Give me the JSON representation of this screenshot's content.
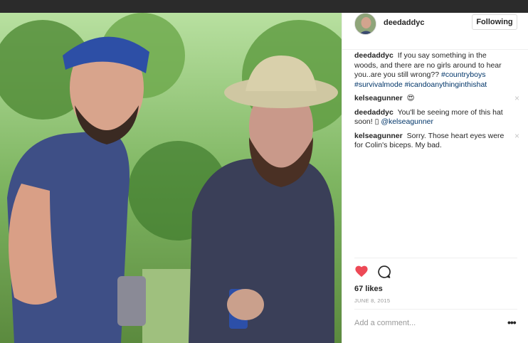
{
  "post": {
    "username": "deedaddyc",
    "follow_label": "Following",
    "caption": {
      "author": "deedaddyc",
      "text": "If you say something in the woods, and there are no girls around to hear you..are you still wrong??",
      "hashtags": "#countryboys #survivalmode #icandoanythinginthishat"
    },
    "comments": [
      {
        "author": "kelseagunner",
        "text": "😍",
        "tag": ""
      },
      {
        "author": "deedaddyc",
        "text": "You'll be seeing more of this hat soon! ▯",
        "tag": "@kelseagunner"
      },
      {
        "author": "kelseagunner",
        "text": "Sorry. Those heart eyes were for Colin's biceps. My bad.",
        "tag": ""
      }
    ],
    "likes": "67 likes",
    "date": "JUNE 8, 2015",
    "add_comment_placeholder": "Add a comment...",
    "more_label": "•••",
    "delete_label": "×"
  },
  "colors": {
    "heart": "#ed4956",
    "link": "#003569",
    "topbar": "#2b2b2b"
  }
}
